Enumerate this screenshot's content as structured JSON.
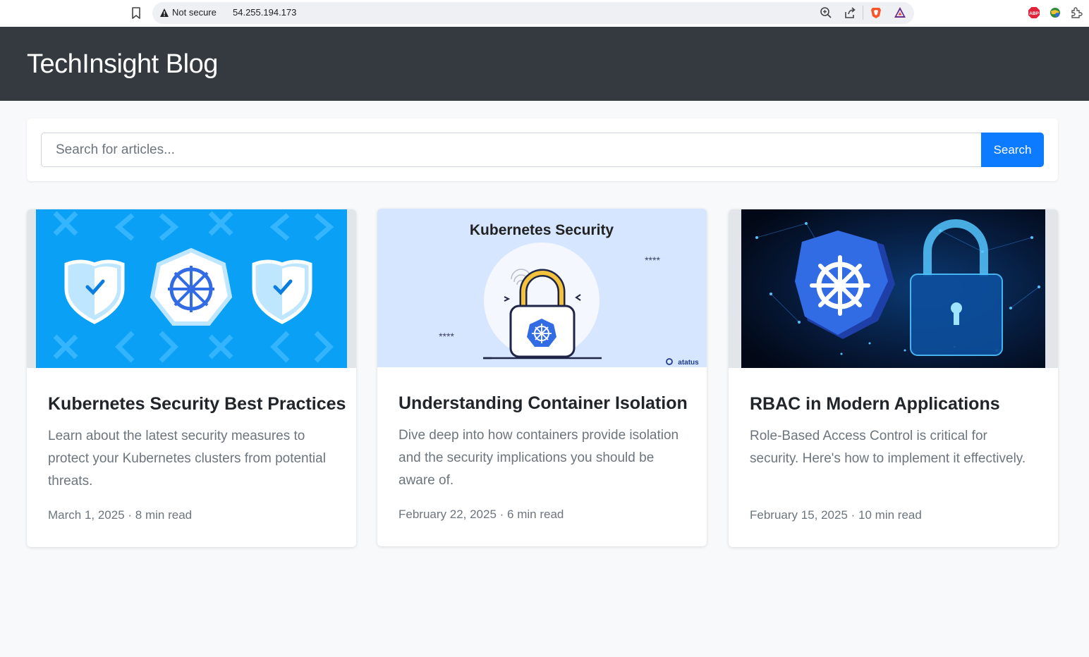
{
  "browser": {
    "security_label": "Not secure",
    "url": "54.255.194.173",
    "icons": [
      "bookmark-icon",
      "warning-icon",
      "zoom-icon",
      "share-icon",
      "brave-shield-icon",
      "brave-rewards-icon",
      "adblock-plus-icon",
      "extension-globe-icon",
      "extensions-puzzle-icon"
    ]
  },
  "header": {
    "title": "TechInsight Blog"
  },
  "search": {
    "placeholder": "Search for articles...",
    "button_label": "Search"
  },
  "articles": [
    {
      "title": "Kubernetes Security Best Practices",
      "description": "Learn about the latest security measures to protect your Kubernetes clusters from potential threats.",
      "date": "March 1, 2025",
      "separator": " · ",
      "read_time": "8 min read",
      "image": "kubernetes-shields-illustration"
    },
    {
      "title": "Understanding Container Isolation",
      "description": "Dive deep into how containers provide isolation and the security implications you should be aware of.",
      "date": "February 22, 2025",
      "separator": " · ",
      "read_time": "6 min read",
      "image": "kubernetes-lock-illustration",
      "image_text": {
        "heading": "Kubernetes Security",
        "dots_a": "****",
        "dots_b": "****",
        "brand": "atatus"
      }
    },
    {
      "title": "RBAC in Modern Applications",
      "description": "Role-Based Access Control is critical for security. Here's how to implement it effectively.",
      "date": "February 15, 2025",
      "separator": " · ",
      "read_time": "10 min read",
      "image": "kubernetes-digital-padlock-illustration"
    }
  ],
  "colors": {
    "header_bg": "#343a40",
    "primary": "#0d7bff",
    "page_bg": "#f8f9fa",
    "kubernetes_blue": "#326ce5"
  }
}
